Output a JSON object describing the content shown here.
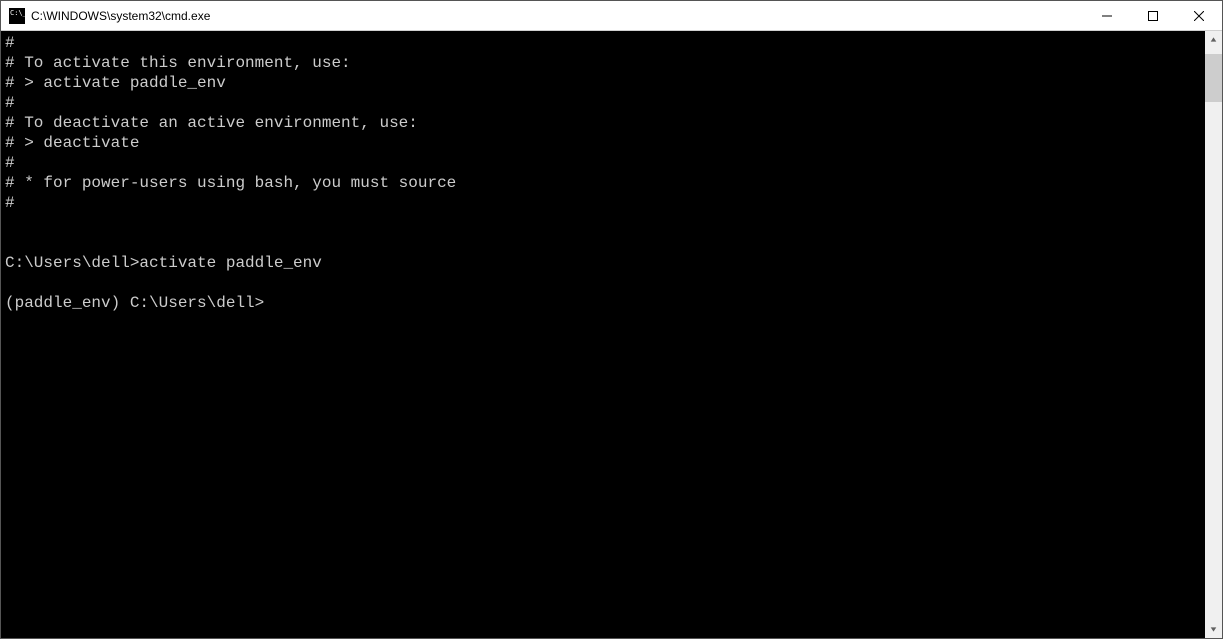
{
  "window": {
    "title": "C:\\WINDOWS\\system32\\cmd.exe"
  },
  "terminal": {
    "lines": [
      "#",
      "# To activate this environment, use:",
      "# > activate paddle_env",
      "#",
      "# To deactivate an active environment, use:",
      "# > deactivate",
      "#",
      "# * for power-users using bash, you must source",
      "#",
      "",
      "",
      "C:\\Users\\dell>activate paddle_env",
      "",
      "(paddle_env) C:\\Users\\dell>"
    ]
  }
}
